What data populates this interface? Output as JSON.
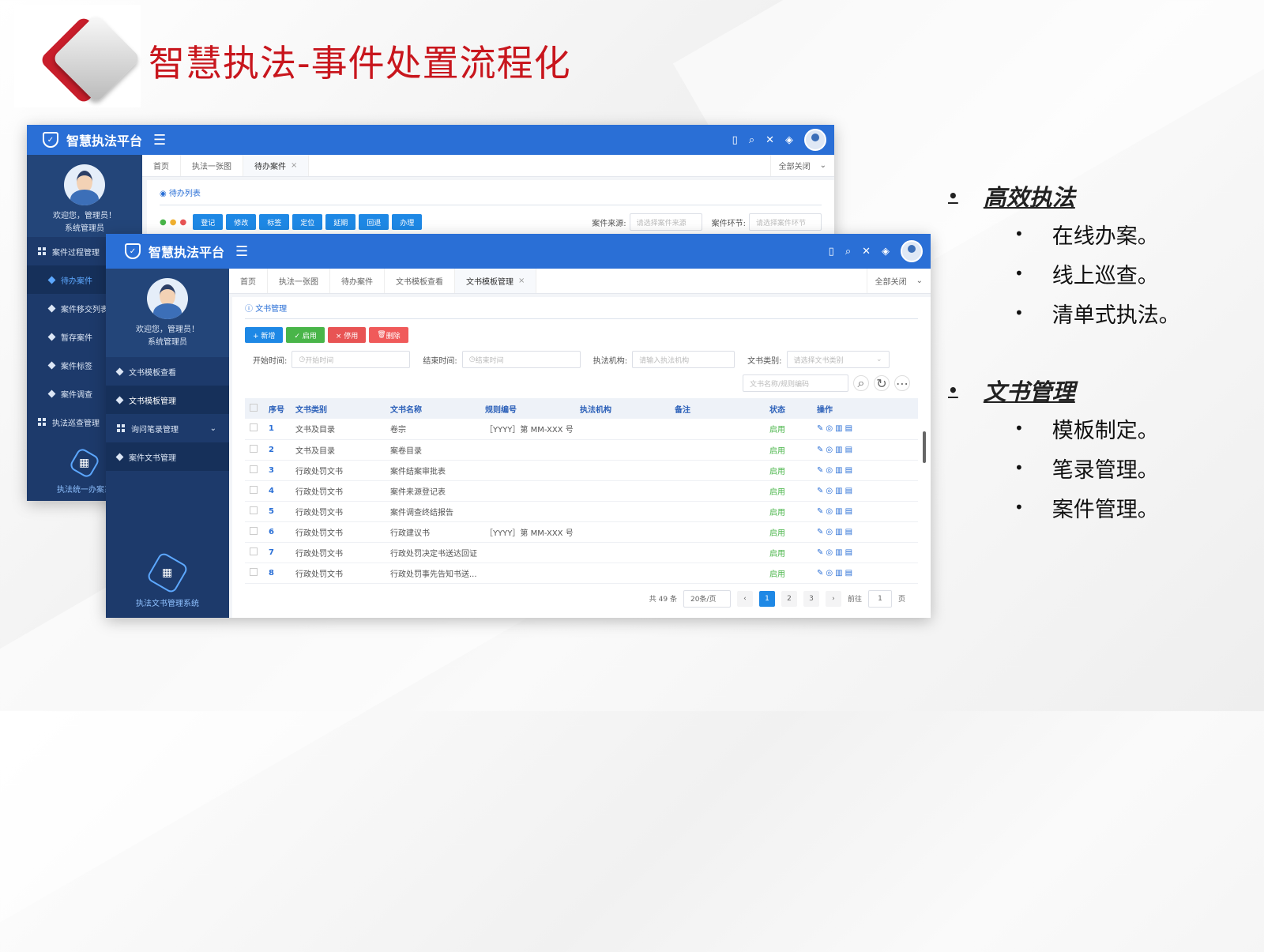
{
  "slide": {
    "title": "智慧执法-事件处置流程化",
    "bullets": [
      {
        "heading": "高效执法",
        "items": [
          "在线办案。",
          "线上巡查。",
          "清单式执法。"
        ]
      },
      {
        "heading": "文书管理",
        "items": [
          "模板制定。",
          "笔录管理。",
          "案件管理。"
        ]
      }
    ]
  },
  "back_window": {
    "brand": "智慧执法平台",
    "welcome": "欢迎您，管理员！",
    "role": "系统管理员",
    "tabs": [
      "首页",
      "执法一张图",
      "待办案件"
    ],
    "close_all": "全部关闭",
    "panel_title": "待办列表",
    "buttons": [
      "登记",
      "修改",
      "标签",
      "定位",
      "延期",
      "回退",
      "办理"
    ],
    "filter_source_label": "案件来源:",
    "filter_source_placeholder": "请选择案件来源",
    "filter_stage_label": "案件环节:",
    "filter_stage_placeholder": "请选择案件环节",
    "menu": [
      {
        "label": "案件过程管理",
        "type": "group"
      },
      {
        "label": "待办案件",
        "type": "sub",
        "active": true
      },
      {
        "label": "案件移交列表",
        "type": "sub"
      },
      {
        "label": "暂存案件",
        "type": "sub"
      },
      {
        "label": "案件标签",
        "type": "sub"
      },
      {
        "label": "案件调查",
        "type": "sub"
      },
      {
        "label": "执法巡查管理",
        "type": "group"
      }
    ],
    "system_name": "执法统一办案系"
  },
  "front_window": {
    "brand": "智慧执法平台",
    "welcome": "欢迎您，管理员！",
    "role": "系统管理员",
    "tabs": [
      "首页",
      "执法一张图",
      "待办案件",
      "文书模板查看",
      "文书模板管理"
    ],
    "close_all": "全部关闭",
    "panel_title": "文书管理",
    "buttons": {
      "add": "+ 新增",
      "enable": "✓ 启用",
      "disable": "× 停用",
      "delete": "删除"
    },
    "filters": {
      "start_label": "开始时间:",
      "start_placeholder": "开始时间",
      "end_label": "结束时间:",
      "end_placeholder": "结束时间",
      "org_label": "执法机构:",
      "org_placeholder": "请输入执法机构",
      "type_label": "文书类别:",
      "type_placeholder": "请选择文书类别",
      "search_placeholder": "文书名称/规则编码"
    },
    "menu": [
      {
        "label": "文书模板查看",
        "type": "item"
      },
      {
        "label": "文书模板管理",
        "type": "item",
        "active": true
      },
      {
        "label": "询问笔录管理",
        "type": "group"
      },
      {
        "label": "案件文书管理",
        "type": "item"
      }
    ],
    "system_name": "执法文书管理系统",
    "table": {
      "headers": [
        "序号",
        "文书类别",
        "文书名称",
        "规则编号",
        "执法机构",
        "备注",
        "状态",
        "操作"
      ],
      "rows": [
        [
          "1",
          "文书及目录",
          "卷宗",
          "［YYYY］第 MM-XXX 号",
          "",
          "",
          "启用"
        ],
        [
          "2",
          "文书及目录",
          "案卷目录",
          "",
          "",
          "",
          "启用"
        ],
        [
          "3",
          "行政处罚文书",
          "案件结案审批表",
          "",
          "",
          "",
          "启用"
        ],
        [
          "4",
          "行政处罚文书",
          "案件来源登记表",
          "",
          "",
          "",
          "启用"
        ],
        [
          "5",
          "行政处罚文书",
          "案件调查终结报告",
          "",
          "",
          "",
          "启用"
        ],
        [
          "6",
          "行政处罚文书",
          "行政建议书",
          "［YYYY］第 MM-XXX 号",
          "",
          "",
          "启用"
        ],
        [
          "7",
          "行政处罚文书",
          "行政处罚决定书送达回证",
          "",
          "",
          "",
          "启用"
        ],
        [
          "8",
          "行政处罚文书",
          "行政处罚事先告知书送...",
          "",
          "",
          "",
          "启用"
        ]
      ]
    },
    "pager": {
      "total": "共 49 条",
      "page_size": "20条/页",
      "pages": [
        "1",
        "2",
        "3"
      ],
      "current": "1",
      "goto_label": "前往",
      "goto_value": "1",
      "page_unit": "页"
    }
  }
}
